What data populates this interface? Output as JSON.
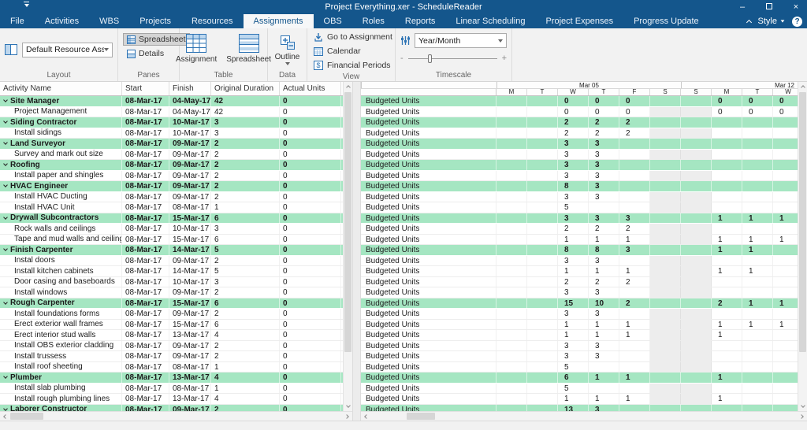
{
  "window": {
    "title": "Project Everything.xer - ScheduleReader"
  },
  "contextual_tab": {
    "label": "Assignments"
  },
  "menubar": {
    "items": [
      {
        "label": "File"
      },
      {
        "label": "Activities"
      },
      {
        "label": "WBS"
      },
      {
        "label": "Projects"
      },
      {
        "label": "Resources"
      },
      {
        "label": "Assignments",
        "active": true
      },
      {
        "label": "OBS"
      },
      {
        "label": "Roles"
      },
      {
        "label": "Reports"
      },
      {
        "label": "Linear Scheduling"
      },
      {
        "label": "Project Expenses"
      },
      {
        "label": "Progress Update",
        "contextual": true
      }
    ],
    "style_label": "Style",
    "help_label": "?"
  },
  "ribbon": {
    "groups": [
      {
        "label": "Layout",
        "layout_dropdown_value": "Default Resource Assignmen"
      },
      {
        "label": "Panes",
        "toggles": [
          {
            "label": "Spreadsheet",
            "selected": true
          },
          {
            "label": "Details",
            "selected": false
          }
        ]
      },
      {
        "label": "Table",
        "buttons": [
          {
            "label": "Assignment"
          },
          {
            "label": "Spreadsheet"
          }
        ]
      },
      {
        "label": "Data",
        "button_label": "Outline"
      },
      {
        "label": "View",
        "items": [
          {
            "label": "Go to Assignment"
          },
          {
            "label": "Calendar"
          },
          {
            "label": "Financial Periods"
          }
        ]
      },
      {
        "label": "Timescale",
        "dropdown_value": "Year/Month",
        "slider": {
          "minus": "-",
          "plus": "+",
          "position_pct": 22
        }
      }
    ]
  },
  "grid": {
    "left_columns": [
      "Activity Name",
      "Start",
      "Finish",
      "Original Duration",
      "Actual Units"
    ],
    "right_label": "Budgeted Units",
    "weeks": [
      {
        "label": "Mar 05",
        "days": [
          "M",
          "T",
          "W",
          "T",
          "F",
          "S"
        ]
      },
      {
        "label": "Mar 12",
        "days": [
          "S",
          "M",
          "T",
          "W"
        ]
      }
    ],
    "weekend_day_indices": [
      5,
      6
    ],
    "rows": [
      {
        "name": "Site Manager",
        "start": "08-Mar-17",
        "finish": "04-May-17",
        "od": "42",
        "au": "0",
        "group": true,
        "units": [
          "",
          "",
          "0",
          "0",
          "0",
          "",
          "",
          "0",
          "0",
          "0"
        ]
      },
      {
        "name": "Project Management",
        "start": "08-Mar-17",
        "finish": "04-May-17",
        "od": "42",
        "au": "0",
        "group": false,
        "units": [
          "",
          "",
          "0",
          "0",
          "0",
          "",
          "",
          "0",
          "0",
          "0"
        ]
      },
      {
        "name": "Siding Contractor",
        "start": "08-Mar-17",
        "finish": "10-Mar-17",
        "od": "3",
        "au": "0",
        "group": true,
        "units": [
          "",
          "",
          "2",
          "2",
          "2",
          "",
          "",
          "",
          "",
          ""
        ]
      },
      {
        "name": "Install sidings",
        "start": "08-Mar-17",
        "finish": "10-Mar-17",
        "od": "3",
        "au": "0",
        "group": false,
        "units": [
          "",
          "",
          "2",
          "2",
          "2",
          "",
          "",
          "",
          "",
          ""
        ]
      },
      {
        "name": "Land Surveyor",
        "start": "08-Mar-17",
        "finish": "09-Mar-17",
        "od": "2",
        "au": "0",
        "group": true,
        "units": [
          "",
          "",
          "3",
          "3",
          "",
          "",
          "",
          "",
          "",
          ""
        ]
      },
      {
        "name": "Survey and mark out size",
        "start": "08-Mar-17",
        "finish": "09-Mar-17",
        "od": "2",
        "au": "0",
        "group": false,
        "units": [
          "",
          "",
          "3",
          "3",
          "",
          "",
          "",
          "",
          "",
          ""
        ]
      },
      {
        "name": "Roofing",
        "start": "08-Mar-17",
        "finish": "09-Mar-17",
        "od": "2",
        "au": "0",
        "group": true,
        "units": [
          "",
          "",
          "3",
          "3",
          "",
          "",
          "",
          "",
          "",
          ""
        ]
      },
      {
        "name": "Install paper and shingles",
        "start": "08-Mar-17",
        "finish": "09-Mar-17",
        "od": "2",
        "au": "0",
        "group": false,
        "units": [
          "",
          "",
          "3",
          "3",
          "",
          "",
          "",
          "",
          "",
          ""
        ]
      },
      {
        "name": "HVAC Engineer",
        "start": "08-Mar-17",
        "finish": "09-Mar-17",
        "od": "2",
        "au": "0",
        "group": true,
        "units": [
          "",
          "",
          "8",
          "3",
          "",
          "",
          "",
          "",
          "",
          ""
        ]
      },
      {
        "name": "Install HVAC Ducting",
        "start": "08-Mar-17",
        "finish": "09-Mar-17",
        "od": "2",
        "au": "0",
        "group": false,
        "units": [
          "",
          "",
          "3",
          "3",
          "",
          "",
          "",
          "",
          "",
          ""
        ]
      },
      {
        "name": "Install HVAC Unit",
        "start": "08-Mar-17",
        "finish": "08-Mar-17",
        "od": "1",
        "au": "0",
        "group": false,
        "units": [
          "",
          "",
          "5",
          "",
          "",
          "",
          "",
          "",
          "",
          ""
        ]
      },
      {
        "name": "Drywall Subcontractors",
        "start": "08-Mar-17",
        "finish": "15-Mar-17",
        "od": "6",
        "au": "0",
        "group": true,
        "units": [
          "",
          "",
          "3",
          "3",
          "3",
          "",
          "",
          "1",
          "1",
          "1"
        ]
      },
      {
        "name": "Rock walls and ceilings",
        "start": "08-Mar-17",
        "finish": "10-Mar-17",
        "od": "3",
        "au": "0",
        "group": false,
        "units": [
          "",
          "",
          "2",
          "2",
          "2",
          "",
          "",
          "",
          "",
          ""
        ]
      },
      {
        "name": "Tape and mud walls and ceilings",
        "start": "08-Mar-17",
        "finish": "15-Mar-17",
        "od": "6",
        "au": "0",
        "group": false,
        "units": [
          "",
          "",
          "1",
          "1",
          "1",
          "",
          "",
          "1",
          "1",
          "1"
        ]
      },
      {
        "name": "Finish Carpenter",
        "start": "08-Mar-17",
        "finish": "14-Mar-17",
        "od": "5",
        "au": "0",
        "group": true,
        "units": [
          "",
          "",
          "8",
          "8",
          "3",
          "",
          "",
          "1",
          "1",
          ""
        ]
      },
      {
        "name": "Instal doors",
        "start": "08-Mar-17",
        "finish": "09-Mar-17",
        "od": "2",
        "au": "0",
        "group": false,
        "units": [
          "",
          "",
          "3",
          "3",
          "",
          "",
          "",
          "",
          "",
          ""
        ]
      },
      {
        "name": "Install kitchen cabinets",
        "start": "08-Mar-17",
        "finish": "14-Mar-17",
        "od": "5",
        "au": "0",
        "group": false,
        "units": [
          "",
          "",
          "1",
          "1",
          "1",
          "",
          "",
          "1",
          "1",
          ""
        ]
      },
      {
        "name": "Door casing and baseboards",
        "start": "08-Mar-17",
        "finish": "10-Mar-17",
        "od": "3",
        "au": "0",
        "group": false,
        "units": [
          "",
          "",
          "2",
          "2",
          "2",
          "",
          "",
          "",
          "",
          ""
        ]
      },
      {
        "name": "Install windows",
        "start": "08-Mar-17",
        "finish": "09-Mar-17",
        "od": "2",
        "au": "0",
        "group": false,
        "units": [
          "",
          "",
          "3",
          "3",
          "",
          "",
          "",
          "",
          "",
          ""
        ]
      },
      {
        "name": "Rough Carpenter",
        "start": "08-Mar-17",
        "finish": "15-Mar-17",
        "od": "6",
        "au": "0",
        "group": true,
        "units": [
          "",
          "",
          "15",
          "10",
          "2",
          "",
          "",
          "2",
          "1",
          "1"
        ]
      },
      {
        "name": "Install foundations forms",
        "start": "08-Mar-17",
        "finish": "09-Mar-17",
        "od": "2",
        "au": "0",
        "group": false,
        "units": [
          "",
          "",
          "3",
          "3",
          "",
          "",
          "",
          "",
          "",
          ""
        ]
      },
      {
        "name": "Erect exterior wall frames",
        "start": "08-Mar-17",
        "finish": "15-Mar-17",
        "od": "6",
        "au": "0",
        "group": false,
        "units": [
          "",
          "",
          "1",
          "1",
          "1",
          "",
          "",
          "1",
          "1",
          "1"
        ]
      },
      {
        "name": "Erect interior stud walls",
        "start": "08-Mar-17",
        "finish": "13-Mar-17",
        "od": "4",
        "au": "0",
        "group": false,
        "units": [
          "",
          "",
          "1",
          "1",
          "1",
          "",
          "",
          "1",
          "",
          ""
        ]
      },
      {
        "name": "Install OBS exterior cladding",
        "start": "08-Mar-17",
        "finish": "09-Mar-17",
        "od": "2",
        "au": "0",
        "group": false,
        "units": [
          "",
          "",
          "3",
          "3",
          "",
          "",
          "",
          "",
          "",
          ""
        ]
      },
      {
        "name": "Install trussess",
        "start": "08-Mar-17",
        "finish": "09-Mar-17",
        "od": "2",
        "au": "0",
        "group": false,
        "units": [
          "",
          "",
          "3",
          "3",
          "",
          "",
          "",
          "",
          "",
          ""
        ]
      },
      {
        "name": "Install roof sheeting",
        "start": "08-Mar-17",
        "finish": "08-Mar-17",
        "od": "1",
        "au": "0",
        "group": false,
        "units": [
          "",
          "",
          "5",
          "",
          "",
          "",
          "",
          "",
          "",
          ""
        ]
      },
      {
        "name": "Plumber",
        "start": "08-Mar-17",
        "finish": "13-Mar-17",
        "od": "4",
        "au": "0",
        "group": true,
        "units": [
          "",
          "",
          "6",
          "1",
          "1",
          "",
          "",
          "1",
          "",
          ""
        ]
      },
      {
        "name": "Install slab plumbing",
        "start": "08-Mar-17",
        "finish": "08-Mar-17",
        "od": "1",
        "au": "0",
        "group": false,
        "units": [
          "",
          "",
          "5",
          "",
          "",
          "",
          "",
          "",
          "",
          ""
        ]
      },
      {
        "name": "Install rough plumbing lines",
        "start": "08-Mar-17",
        "finish": "13-Mar-17",
        "od": "4",
        "au": "0",
        "group": false,
        "units": [
          "",
          "",
          "1",
          "1",
          "1",
          "",
          "",
          "1",
          "",
          ""
        ]
      },
      {
        "name": "Laborer Constructor",
        "start": "08-Mar-17",
        "finish": "09-Mar-17",
        "od": "2",
        "au": "0",
        "group": true,
        "units": [
          "",
          "",
          "13",
          "3",
          "",
          "",
          "",
          "",
          "",
          ""
        ]
      }
    ]
  },
  "colors": {
    "titlebar_blue": "#14568C",
    "contextual_blue": "#10496B",
    "contextual_green": "#6FBE4B",
    "contextual_text_green": "#8FCE4F",
    "accent_blue": "#2E74B5",
    "icon_fill_blue": "#BDD7EE",
    "group_row_green": "#A5E6C2",
    "weekend_gray": "#EDEDED",
    "ribbon_bg": "#F2F2F2",
    "selected_toggle_gray": "#D4D4D4"
  }
}
